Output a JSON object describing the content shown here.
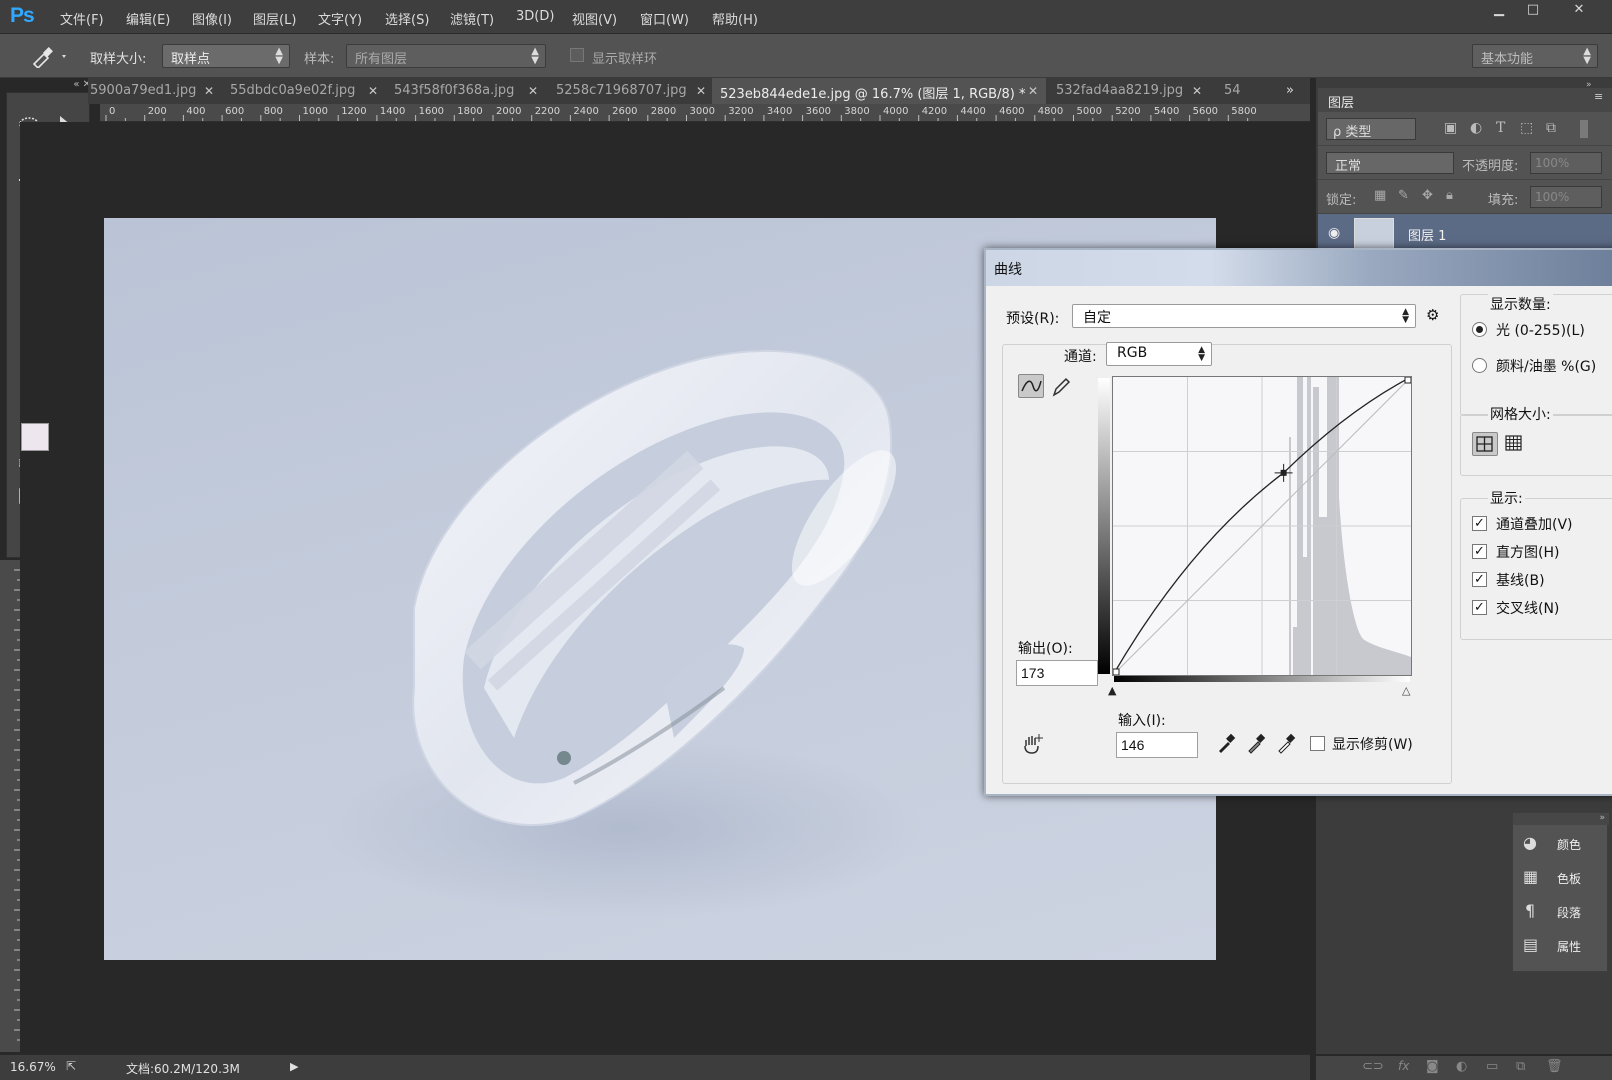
{
  "app": {
    "logo": "Ps"
  },
  "menu": [
    "文件(F)",
    "编辑(E)",
    "图像(I)",
    "图层(L)",
    "文字(Y)",
    "选择(S)",
    "滤镜(T)",
    "3D(D)",
    "视图(V)",
    "窗口(W)",
    "帮助(H)"
  ],
  "window_controls": {
    "minimize": "▁",
    "maximize": "□",
    "close": "✕"
  },
  "options": {
    "sample_size_label": "取样大小:",
    "sample_size_value": "取样点",
    "sample_label": "样本:",
    "sample_value": "所有图层",
    "show_ring_label": "显示取样环",
    "workspace": "基本功能"
  },
  "tabs": [
    {
      "label": "5900a79ed1.jpg",
      "active": false
    },
    {
      "label": "55dbdc0a9e02f.jpg",
      "active": false
    },
    {
      "label": "543f58f0f368a.jpg",
      "active": false
    },
    {
      "label": "5258c71968707.jpg",
      "active": false
    },
    {
      "label": "523eb844ede1e.jpg @ 16.7% (图层 1, RGB/8) *",
      "active": true
    },
    {
      "label": "532fad4aa8219.jpg",
      "active": false
    },
    {
      "label": "54",
      "active": false
    }
  ],
  "tab_overflow": "»",
  "ruler_ticks": [
    "0",
    "200",
    "400",
    "600",
    "800",
    "1000",
    "1200",
    "1400",
    "1600",
    "1800",
    "2000",
    "2200",
    "2400",
    "2600",
    "2800",
    "3000",
    "3200",
    "3400",
    "3600",
    "3800",
    "4000",
    "4200",
    "4400",
    "4600",
    "4800",
    "5000",
    "5200",
    "5400",
    "5600",
    "5800"
  ],
  "status": {
    "zoom": "16.67%",
    "doc": "文档:60.2M/120.3M"
  },
  "layers": {
    "title": "图层",
    "filter_kind": "ρ 类型",
    "blend_mode": "正常",
    "opacity_label": "不透明度:",
    "opacity_value": "100%",
    "lock_label": "锁定:",
    "fill_label": "填充:",
    "fill_value": "100%",
    "layer_name": "图层 1"
  },
  "mini_panels": [
    "颜色",
    "色板",
    "段落",
    "属性"
  ],
  "curves": {
    "title": "曲线",
    "preset_label": "预设(R):",
    "preset_value": "自定",
    "channel_label": "通道:",
    "channel_value": "RGB",
    "output_label": "输出(O):",
    "output_value": "173",
    "input_label": "输入(I):",
    "input_value": "146",
    "show_clipping_label": "显示修剪(W)",
    "show_amount_label": "显示数量:",
    "light_label": "光 (0-255)(L)",
    "pigment_label": "颜料/油墨 %(G)",
    "grid_size_label": "网格大小:",
    "show_label": "显示:",
    "channel_overlay_label": "通道叠加(V)",
    "histogram_label": "直方图(H)",
    "baseline_label": "基线(B)",
    "intersection_label": "交叉线(N)",
    "point": {
      "input": 146,
      "output": 173
    }
  }
}
